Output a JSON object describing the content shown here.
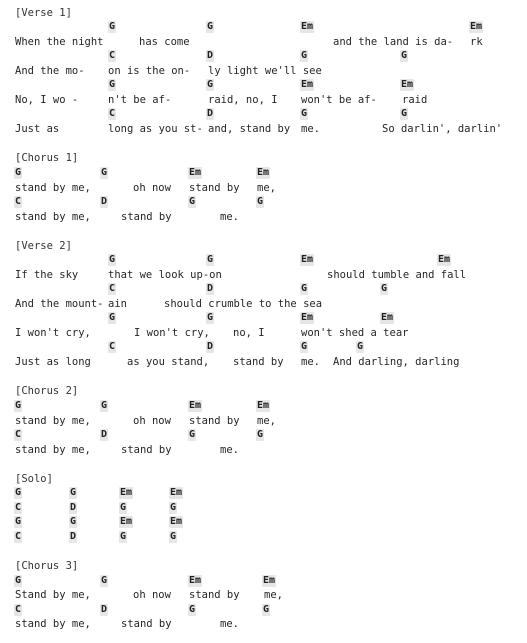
{
  "sections": [
    {
      "header": "[Verse 1]",
      "lines": [
        {
          "chords": [
            "G",
            "G",
            "Em",
            "Em"
          ],
          "lyrics": [
            "When the night",
            "has come",
            "",
            "and the land is da-",
            "rk"
          ]
        },
        {
          "chords": [
            "C",
            "D",
            "G",
            "G"
          ],
          "lyrics": [
            "And the mo-",
            "on is the on-",
            "ly light we'll see",
            ""
          ]
        },
        {
          "chords": [
            "G",
            "G",
            "Em",
            "Em"
          ],
          "lyrics": [
            "No, I wo -",
            "n't be af-",
            "raid, no, I",
            "won't be af-",
            "raid"
          ]
        },
        {
          "chords": [
            "C",
            "D",
            "G",
            "G"
          ],
          "lyrics": [
            "Just as",
            "long as you st-",
            "and, stand by",
            "me.",
            "So darlin', darlin'"
          ]
        }
      ]
    },
    {
      "header": "[Chorus 1]",
      "lines": [
        {
          "chords": [
            "G",
            "G",
            "Em",
            "Em"
          ],
          "lyrics": [
            "stand by me,",
            "oh now",
            "stand by",
            "me,"
          ]
        },
        {
          "chords": [
            "C",
            "D",
            "G",
            "G"
          ],
          "lyrics": [
            "stand by me,",
            "stand by",
            "me."
          ]
        }
      ]
    },
    {
      "header": "[Verse 2]",
      "lines": [
        {
          "chords": [
            "G",
            "G",
            "Em",
            "Em"
          ],
          "lyrics": [
            "If the sky",
            "that we look up-on",
            "",
            "should tumble and fall"
          ]
        },
        {
          "chords": [
            "C",
            "D",
            "G",
            "G"
          ],
          "lyrics": [
            "And the mount-",
            "ain",
            "should crumble to the sea",
            ""
          ]
        },
        {
          "chords": [
            "G",
            "G",
            "Em",
            "Em"
          ],
          "lyrics": [
            "I won't cry,",
            "I won't cry,",
            "no, I",
            "won't shed a tear"
          ]
        },
        {
          "chords": [
            "C",
            "D",
            "G",
            "G"
          ],
          "lyrics": [
            "Just as long",
            "as you stand,",
            "stand by",
            "me.",
            "And darling, darling"
          ]
        }
      ]
    },
    {
      "header": "[Chorus 2]",
      "lines": [
        {
          "chords": [
            "G",
            "G",
            "Em",
            "Em"
          ],
          "lyrics": [
            "stand by me,",
            "oh now",
            "stand by",
            "me,"
          ]
        },
        {
          "chords": [
            "C",
            "D",
            "G",
            "G"
          ],
          "lyrics": [
            "stand by me,",
            "stand by",
            "me."
          ]
        }
      ]
    },
    {
      "header": "[Solo]",
      "lines": [
        {
          "chords": [
            "G",
            "G",
            "Em",
            "Em"
          ],
          "lyrics": []
        },
        {
          "chords": [
            "C",
            "D",
            "G",
            "G"
          ],
          "lyrics": []
        },
        {
          "chords": [
            "G",
            "G",
            "Em",
            "Em"
          ],
          "lyrics": []
        },
        {
          "chords": [
            "C",
            "D",
            "G",
            "G"
          ],
          "lyrics": []
        }
      ]
    },
    {
      "header": "[Chorus 3]",
      "lines": [
        {
          "chords": [
            "G",
            "G",
            "Em",
            "Em"
          ],
          "lyrics": [
            "Stand by me,",
            "oh now",
            "stand by",
            "me,"
          ]
        },
        {
          "chords": [
            "C",
            "D",
            "G",
            "G"
          ],
          "lyrics": [
            "stand by me,",
            "stand by",
            "me."
          ]
        }
      ]
    }
  ]
}
